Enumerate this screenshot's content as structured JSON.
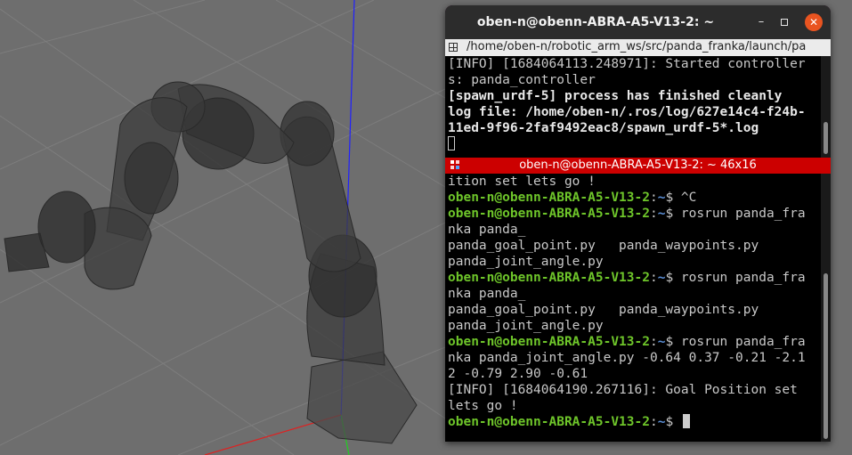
{
  "terminal": {
    "window_title": "oben-n@obenn-ABRA-A5-V13-2: ~",
    "tab_path": "/home/oben-n/robotic_arm_ws/src/panda_franka/launch/pa",
    "pane1_lines": [
      {
        "text": "[INFO] [1684064113.248971]: Started controller",
        "bold": false
      },
      {
        "text": "s: panda_controller",
        "bold": false
      },
      {
        "text": "[spawn_urdf-5] process has finished cleanly",
        "bold": true
      },
      {
        "text": "log file: /home/oben-n/.ros/log/627e14c4-f24b-",
        "bold": true
      },
      {
        "text": "11ed-9f96-2faf9492eac8/spawn_urdf-5*.log",
        "bold": true
      }
    ],
    "pane2_title": "oben-n@obenn-ABRA-A5-V13-2: ~ 46x16",
    "prompt_user": "oben-n@obenn-ABRA-A5-V13-2",
    "prompt_path": "~",
    "pane2_lines": [
      {
        "prompt": false,
        "text": "ition set lets go !"
      },
      {
        "prompt": true,
        "text": "$ ^C"
      },
      {
        "prompt": true,
        "text": "$ rosrun panda_fra"
      },
      {
        "prompt": false,
        "text": "nka panda_"
      },
      {
        "prompt": false,
        "text": "panda_goal_point.py   panda_waypoints.py"
      },
      {
        "prompt": false,
        "text": "panda_joint_angle.py"
      },
      {
        "prompt": true,
        "text": "$ rosrun panda_fra"
      },
      {
        "prompt": false,
        "text": "nka panda_"
      },
      {
        "prompt": false,
        "text": "panda_goal_point.py   panda_waypoints.py"
      },
      {
        "prompt": false,
        "text": "panda_joint_angle.py"
      },
      {
        "prompt": true,
        "text": "$ rosrun panda_fra"
      },
      {
        "prompt": false,
        "text": "nka panda_joint_angle.py -0.64 0.37 -0.21 -2.1"
      },
      {
        "prompt": false,
        "text": "2 -0.79 2.90 -0.61"
      },
      {
        "prompt": false,
        "text": "[INFO] [1684064190.267116]: Goal Position set"
      },
      {
        "prompt": false,
        "text": "lets go !"
      },
      {
        "prompt": true,
        "text": "$ ",
        "cursor": true
      }
    ]
  },
  "colors": {
    "terminal_bg": "#000000",
    "prompt_user": "#6ec52a",
    "prompt_path": "#5b8fd6",
    "pane_header": "#cc0000",
    "close_button": "#e95420",
    "sim_background": "#6e6e6e"
  },
  "icons": {
    "minimize": "minimize-icon",
    "maximize": "maximize-icon",
    "close": "close-icon",
    "terminal_split": "split-terminal-icon"
  }
}
